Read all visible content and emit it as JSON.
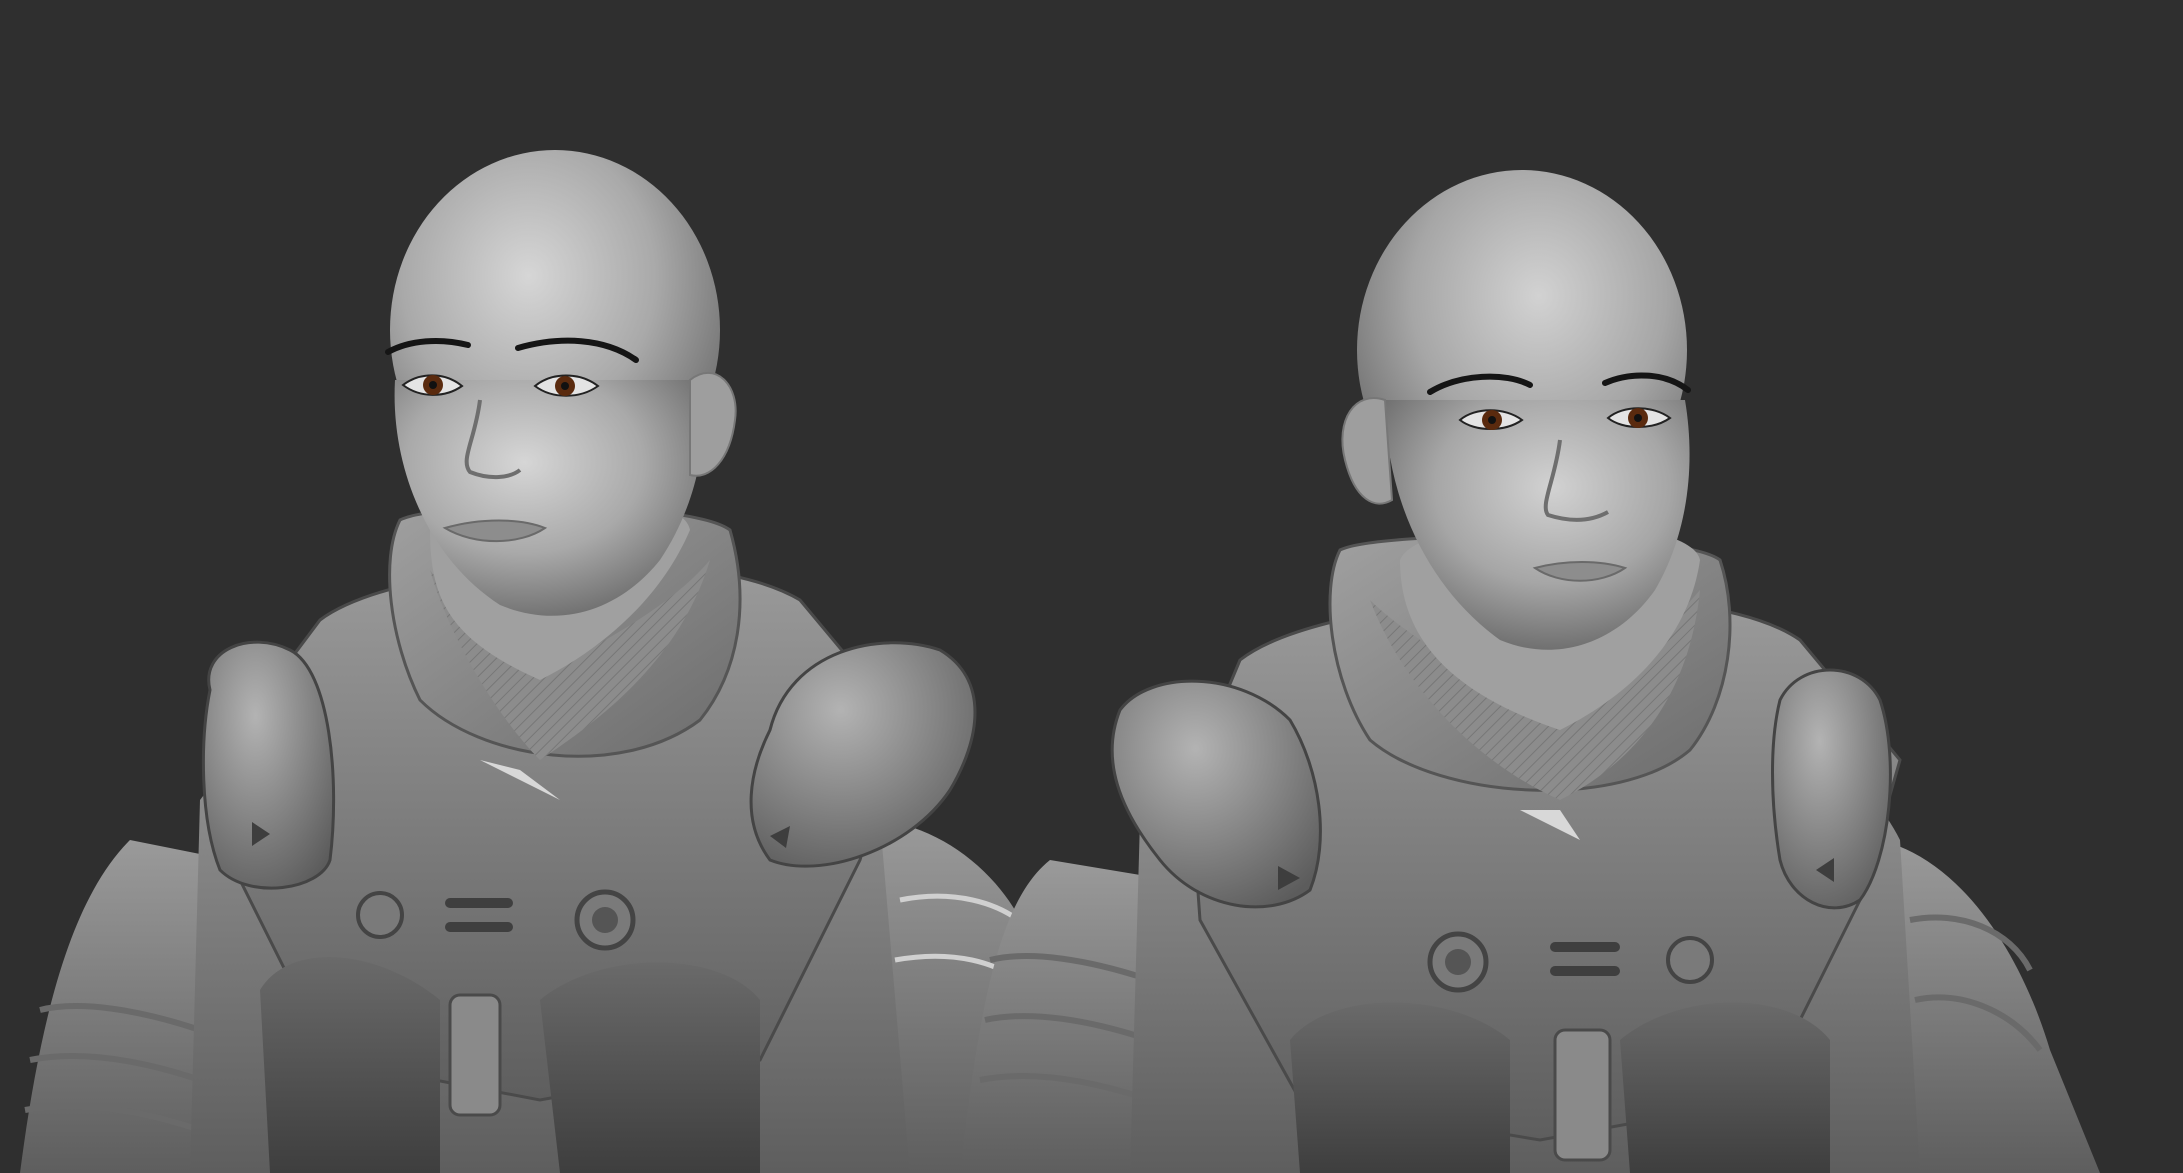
{
  "scene": {
    "background_color": "#2f2f2f",
    "material_light": "#bdbdbd",
    "material_mid": "#8f8f8f",
    "material_dark": "#5a5a5a",
    "iris_color": "#5a2a0e",
    "figures": [
      {
        "name": "left-figure",
        "facing": "three-quarter-left"
      },
      {
        "name": "right-figure",
        "facing": "front"
      }
    ]
  }
}
